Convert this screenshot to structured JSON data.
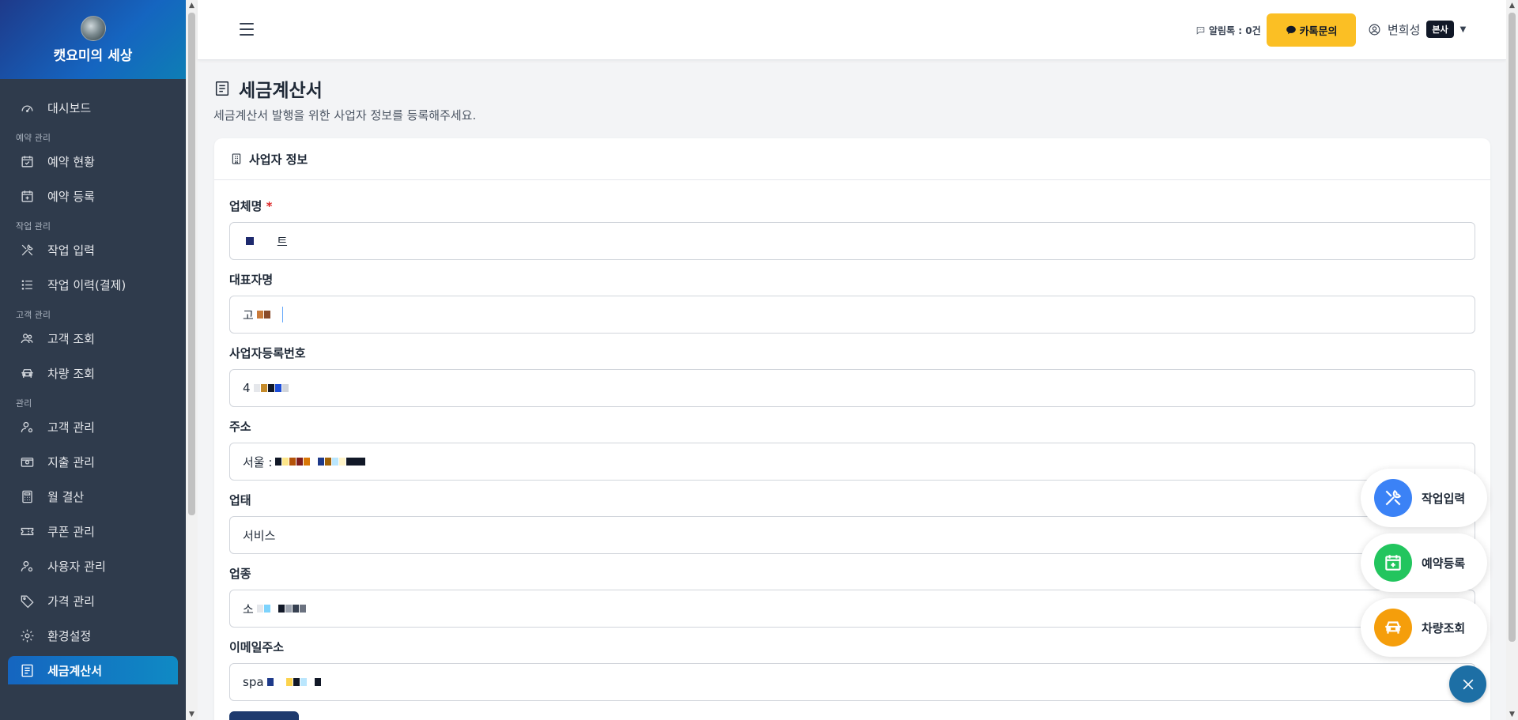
{
  "sidebar": {
    "brand_title": "캣요미의 세상",
    "items": [
      {
        "label": "대시보드"
      },
      {
        "section": "예약 관리"
      },
      {
        "label": "예약 현황"
      },
      {
        "label": "예약 등록"
      },
      {
        "section": "작업 관리"
      },
      {
        "label": "작업 입력"
      },
      {
        "label": "작업 이력(결제)"
      },
      {
        "section": "고객 관리"
      },
      {
        "label": "고객 조회"
      },
      {
        "label": "차량 조회"
      },
      {
        "section": "관리"
      },
      {
        "label": "고객 관리"
      },
      {
        "label": "지출 관리"
      },
      {
        "label": "월 결산"
      },
      {
        "label": "쿠폰 관리"
      },
      {
        "label": "사용자 관리"
      },
      {
        "label": "가격 관리"
      },
      {
        "label": "환경설정"
      },
      {
        "label": "세금계산서"
      }
    ]
  },
  "header": {
    "alimtalk": "알림톡 : 0건",
    "kakao_button": "카톡문의",
    "user_name": "변희성",
    "user_badge": "본사"
  },
  "page": {
    "title": "세금계산서",
    "subtitle": "세금계산서 발행을 위한 사업자 정보를 등록해주세요."
  },
  "card": {
    "header": "사업자 정보",
    "fields": {
      "company": {
        "label": "업체명",
        "required": "*",
        "value_start": "",
        "value_end": "트"
      },
      "ceo": {
        "label": "대표자명",
        "value_start": "고"
      },
      "bizno": {
        "label": "사업자등록번호",
        "value_start": "4"
      },
      "address": {
        "label": "주소",
        "value_start": "서울 :"
      },
      "biz_type": {
        "label": "업태",
        "value": "서비스"
      },
      "biz_item": {
        "label": "업종",
        "value_start": "소"
      },
      "email": {
        "label": "이메일주소",
        "value_start": "spa"
      }
    }
  },
  "fabs": [
    {
      "label": "작업입력",
      "color": "#3b82f6",
      "icon": "tools-icon"
    },
    {
      "label": "예약등록",
      "color": "#22c55e",
      "icon": "calendar-plus-icon"
    },
    {
      "label": "차량조회",
      "color": "#f59e0b",
      "icon": "car-icon"
    }
  ],
  "colors": {
    "sidebar_bg": "#2f3b4c",
    "brand_gradient_start": "#1e3a8a",
    "kakao_yellow": "#fbbf24",
    "required_red": "#dc2626",
    "fab_close": "#1d6fa5"
  }
}
